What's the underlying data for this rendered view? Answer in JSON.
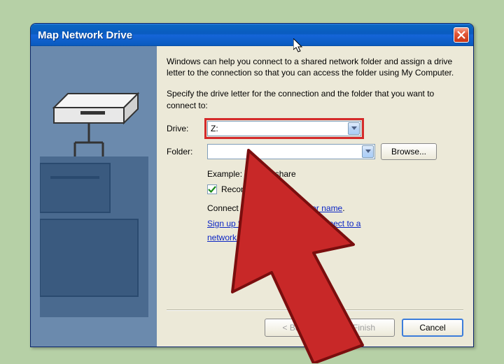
{
  "window": {
    "title": "Map Network Drive"
  },
  "content": {
    "intro": "Windows can help you connect to a shared network folder and assign a drive letter to the connection so that you can access the folder using My Computer.",
    "instruct": "Specify the drive letter for the connection and the folder that you want to connect to:",
    "drive_label": "Drive:",
    "drive_value": "Z:",
    "folder_label": "Folder:",
    "folder_value": "",
    "browse_label": "Browse...",
    "example_prefix": "Example: ",
    "example_value": "\\\\server\\share",
    "reconnect_label": "Reconnect at logon",
    "reconnect_checked": true,
    "connect_prefix": "Connect using a ",
    "connect_link": "different user name",
    "connect_suffix": ".",
    "signup_link_1": "Sign up for online storage or connect to a",
    "signup_link_2": "network server",
    "signup_suffix": "."
  },
  "buttons": {
    "back": "< Back",
    "finish": "Finish",
    "cancel": "Cancel"
  }
}
